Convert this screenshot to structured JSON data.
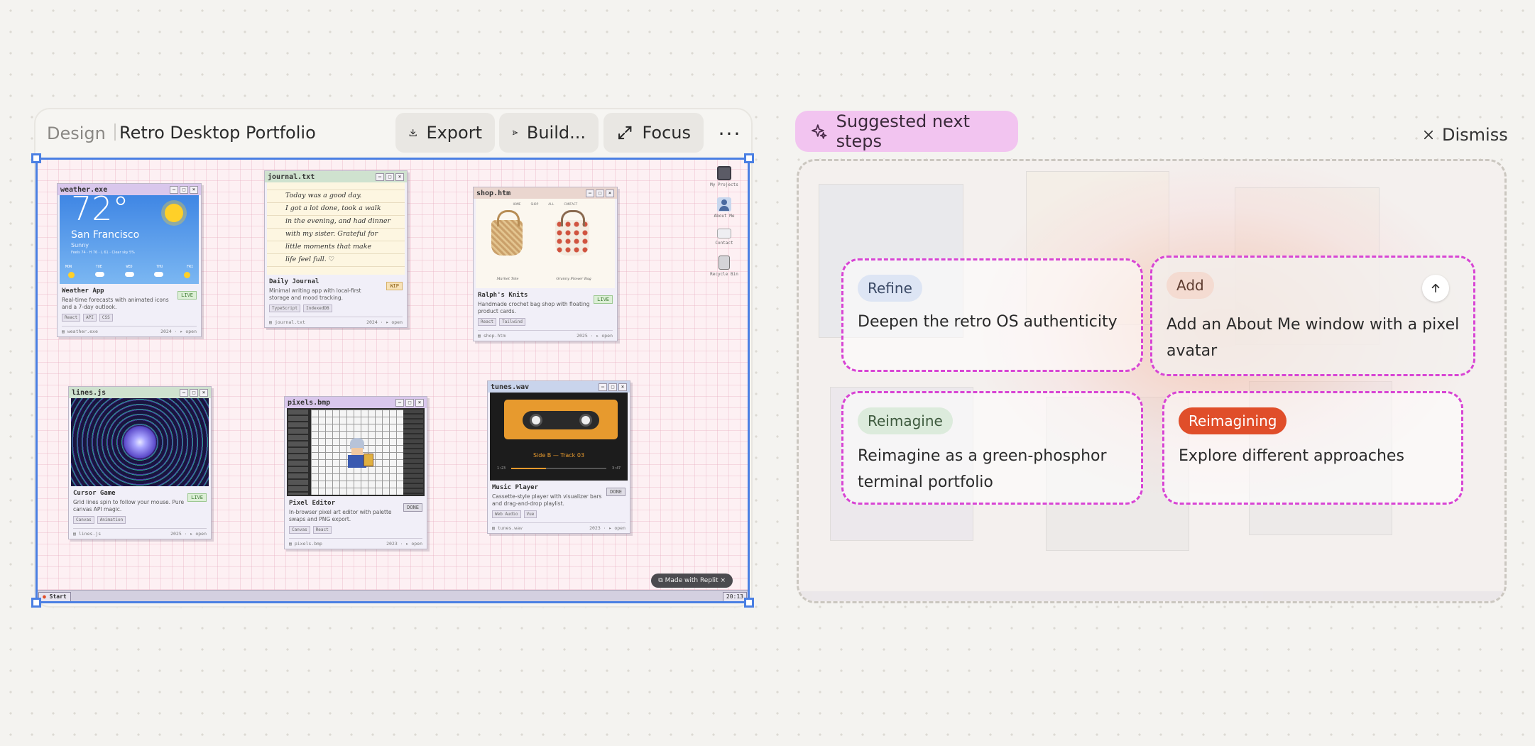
{
  "header": {
    "breadcrumb_section": "Design",
    "project_title": "Retro Desktop Portfolio",
    "export_label": "Export",
    "build_label": "Build...",
    "focus_label": "Focus",
    "more_label": "···"
  },
  "desktop": {
    "windows": [
      {
        "title": "weather.exe",
        "name": "Weather App",
        "desc": "Real-time forecasts with animated icons and a 7-day outlook.",
        "status": "LIVE",
        "tags": [
          "React",
          "API",
          "CSS"
        ],
        "file": "weather.exe",
        "year": "2024",
        "open": "▸ open",
        "preview": {
          "temp": "72°",
          "city": "San Francisco",
          "cond": "Sunny",
          "detail": "Feels 74 · H 76 · L 61 · Clear sky 5%",
          "days": [
            "MON",
            "TUE",
            "WED",
            "THU",
            "FRI"
          ]
        }
      },
      {
        "title": "journal.txt",
        "name": "Daily Journal",
        "desc": "Minimal writing app with local-first storage and mood tracking.",
        "status": "WIP",
        "tags": [
          "TypeScript",
          "IndexedDB"
        ],
        "file": "journal.txt",
        "year": "2024",
        "open": "▸ open",
        "preview": {
          "lines": [
            "Today was a good day.",
            "I got a lot done, took a walk",
            "in the evening, and had dinner",
            "with my sister. Grateful for",
            "little moments that make",
            "life feel full. ♡"
          ]
        }
      },
      {
        "title": "shop.htm",
        "name": "Ralph's Knits",
        "desc": "Handmade crochet bag shop with floating product cards.",
        "status": "LIVE",
        "tags": [
          "React",
          "Tailwind"
        ],
        "file": "shop.htm",
        "year": "2025",
        "open": "▸ open",
        "preview": {
          "nav": [
            "HOME",
            "SHOP",
            "ALL",
            "CONTACT"
          ],
          "items": [
            "Market Tote",
            "Granny Flower Bag"
          ]
        }
      },
      {
        "title": "lines.js",
        "name": "Cursor Game",
        "desc": "Grid lines spin to follow your mouse. Pure canvas API magic.",
        "status": "LIVE",
        "tags": [
          "Canvas",
          "Animation"
        ],
        "file": "lines.js",
        "year": "2025",
        "open": "▸ open"
      },
      {
        "title": "pixels.bmp",
        "name": "Pixel Editor",
        "desc": "In-browser pixel art editor with palette swaps and PNG export.",
        "status": "DONE",
        "tags": [
          "Canvas",
          "React"
        ],
        "file": "pixels.bmp",
        "year": "2023",
        "open": "▸ open"
      },
      {
        "title": "tunes.wav",
        "name": "Music Player",
        "desc": "Cassette-style player with visualizer bars and drag-and-drop playlist.",
        "status": "DONE",
        "tags": [
          "Web Audio",
          "Vue"
        ],
        "file": "tunes.wav",
        "year": "2023",
        "open": "▸ open",
        "preview": {
          "track": "Side B — Track 03",
          "elapsed": "1:23",
          "total": "3:47"
        }
      }
    ],
    "icons": [
      {
        "label": "My Projects",
        "icon": "floppy-icon"
      },
      {
        "label": "About Me",
        "icon": "person-icon"
      },
      {
        "label": "Contact",
        "icon": "envelope-icon"
      },
      {
        "label": "Recycle Bin",
        "icon": "trash-icon"
      }
    ],
    "taskbar": {
      "start": "Start",
      "clock": "20:13"
    },
    "replit_badge": "Made with Replit",
    "replit_close": "×"
  },
  "suggestions": {
    "pill_label": "Suggested next steps",
    "dismiss_label": "Dismiss",
    "cards": [
      {
        "chip": "Refine",
        "text": "Deepen the retro OS authenticity"
      },
      {
        "chip": "Add",
        "text": "Add an About Me window with a pixel avatar"
      },
      {
        "chip": "Reimagine",
        "text": "Reimagine as a green-phosphor terminal portfolio"
      },
      {
        "chip": "Reimagining",
        "text": "Explore different approaches"
      }
    ]
  },
  "colors": {
    "accent_selection": "#4a7fe3",
    "suggest_pill": "#f2c4f0",
    "card_border": "#d845d4",
    "reimagining_chip": "#e04e2a"
  }
}
